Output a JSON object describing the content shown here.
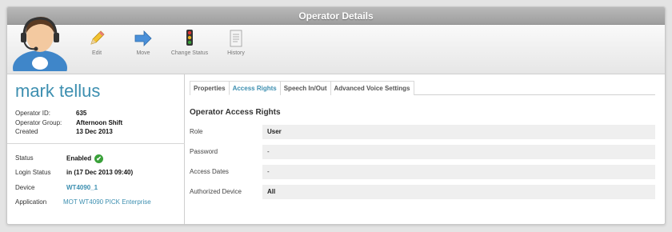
{
  "window": {
    "title": "Operator Details"
  },
  "toolbar": {
    "edit": "Edit",
    "move": "Move",
    "change_status": "Change Status",
    "history": "History"
  },
  "operator": {
    "name": "mark tellus",
    "id_label": "Operator ID:",
    "id_value": "635",
    "group_label": "Operator Group:",
    "group_value": "Afternoon Shift",
    "created_label": "Created",
    "created_value": "13 Dec 2013",
    "status_label": "Status",
    "status_value": "Enabled",
    "login_label": "Login Status",
    "login_value": "in (17 Dec 2013 09:40)",
    "device_label": "Device",
    "device_value": "WT4090_1",
    "application_label": "Application",
    "application_value": "MOT WT4090 PICK Enterprise"
  },
  "tabs": [
    {
      "label": "Properties",
      "active": false
    },
    {
      "label": "Access Rights",
      "active": true
    },
    {
      "label": "Speech In/Out",
      "active": false
    },
    {
      "label": "Advanced Voice Settings",
      "active": false
    }
  ],
  "access_rights": {
    "title": "Operator Access Rights",
    "rows": [
      {
        "label": "Role",
        "value": "User"
      },
      {
        "label": "Password",
        "value": "-"
      },
      {
        "label": "Access Dates",
        "value": "-"
      },
      {
        "label": "Authorized Device",
        "value": "All"
      }
    ]
  },
  "colors": {
    "accent": "#3d8fb0",
    "status_ok": "#3aa13a"
  },
  "icons": [
    "operator-avatar-icon",
    "pencil-icon",
    "arrow-right-icon",
    "traffic-light-icon",
    "document-icon",
    "checkmark-icon"
  ]
}
